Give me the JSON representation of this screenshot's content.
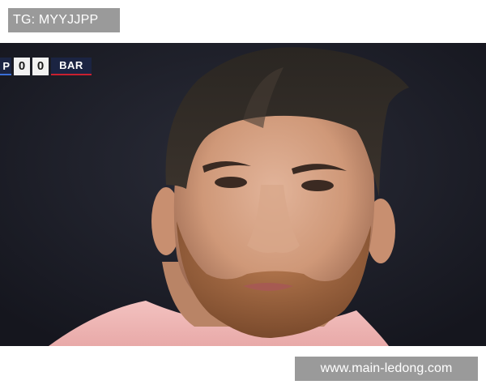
{
  "header": {
    "tag_text": "TG: MYYJJPP"
  },
  "scorebug": {
    "home_team": "P",
    "home_score": "0",
    "away_score": "0",
    "away_team": "BAR",
    "home_color": "#3a6fd8",
    "away_color": "#c8202f"
  },
  "footer": {
    "website_text": "www.main-ledong.com"
  },
  "colors": {
    "badge_background": "#9a9a9a",
    "photo_background": "#1d1f29",
    "jersey": "#f0b8b8"
  }
}
